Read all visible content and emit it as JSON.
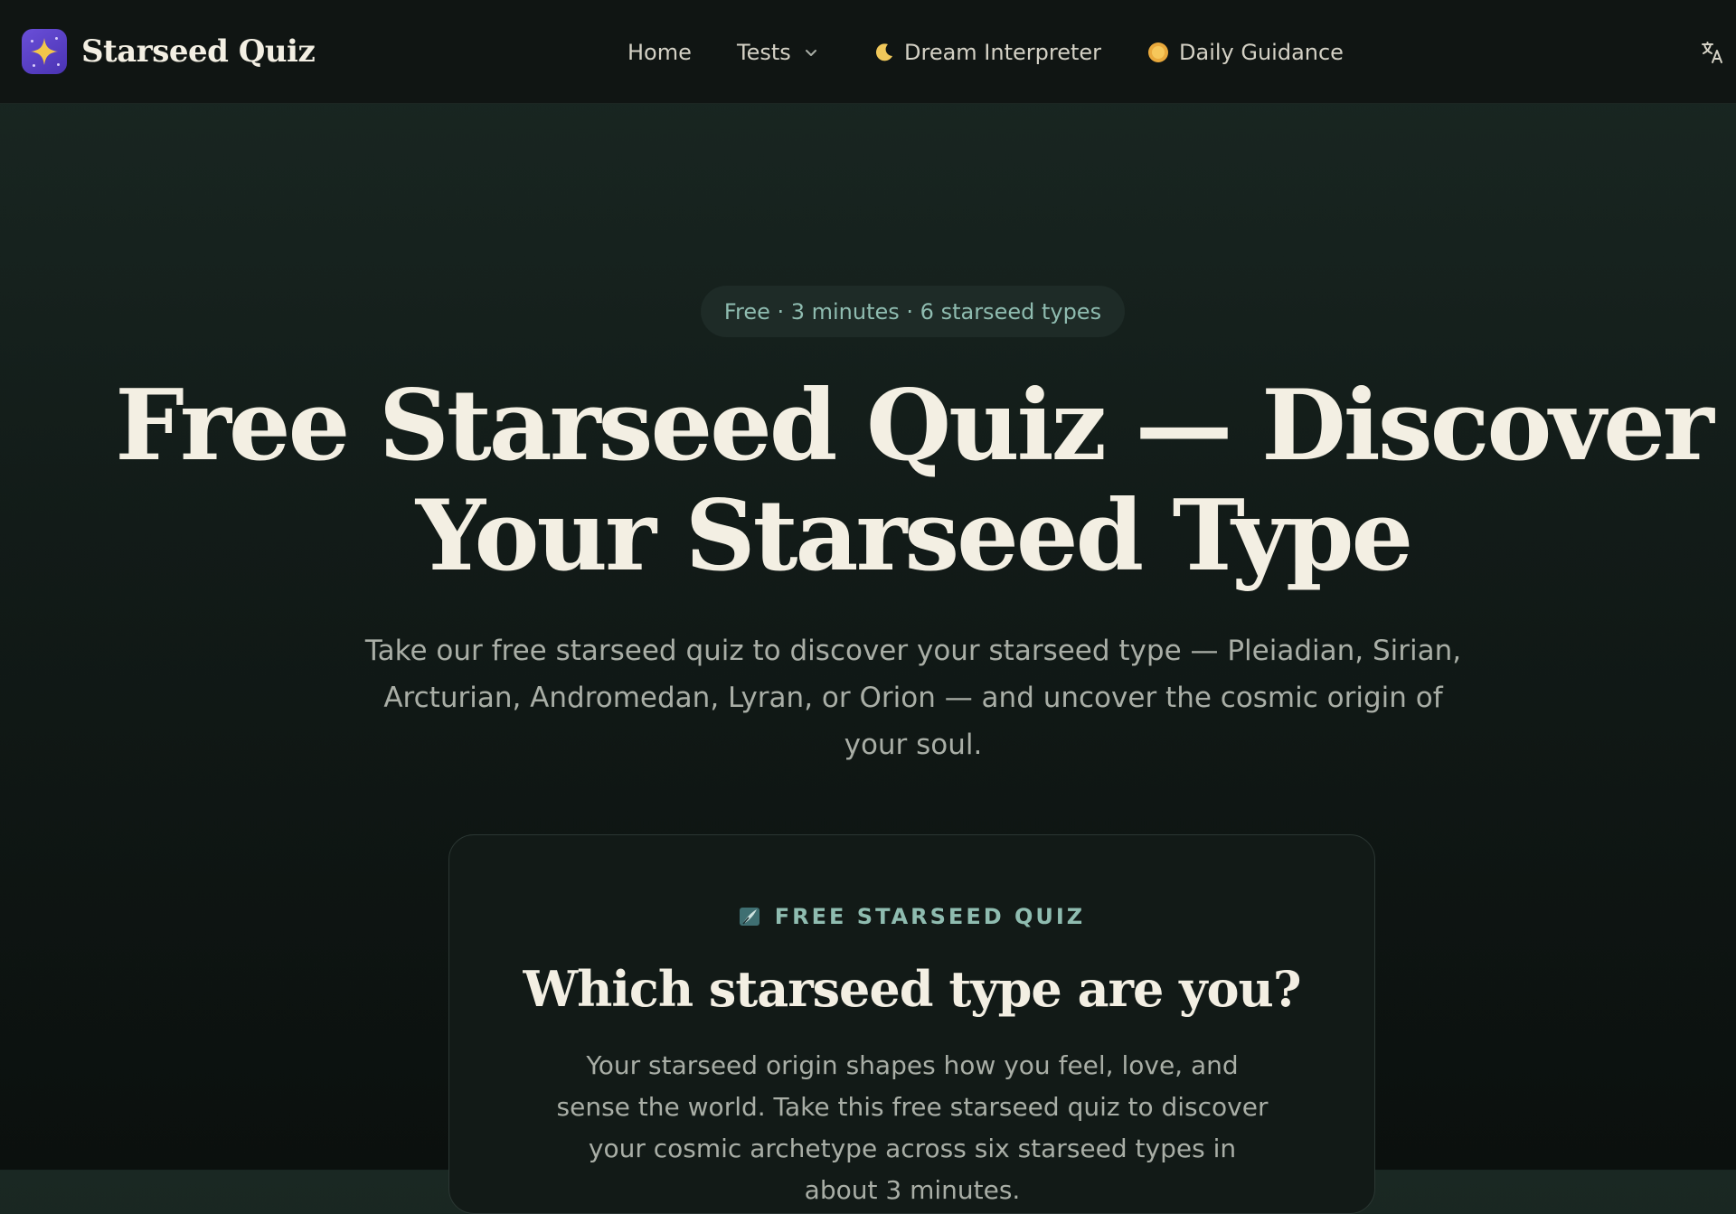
{
  "header": {
    "brand_name": "Starseed Quiz",
    "nav": {
      "home": "Home",
      "tests": "Tests",
      "dream": "Dream Interpreter",
      "daily": "Daily Guidance"
    },
    "icons": {
      "brand": "sparkle-star-icon",
      "tests_dropdown": "chevron-down-icon",
      "dream": "crescent-moon-icon",
      "daily": "sun-icon",
      "language": "translate-icon"
    }
  },
  "hero": {
    "badge": "Free · 3 minutes · 6 starseed types",
    "title_line1": "Free Starseed Quiz — Discover",
    "title_line2": "Your Starseed Type",
    "subtitle": "Take our free starseed quiz to discover your starseed type — Pleiadian, Sirian, Arcturian, Andromedan, Lyran, or Orion — and uncover the cosmic origin of your soul."
  },
  "quiz_card": {
    "kicker": "FREE STARSEED QUIZ",
    "kicker_icon": "quill-pen-icon",
    "title": "Which starseed type are you?",
    "body": "Your starseed origin shapes how you feel, love, and sense the world. Take this free starseed quiz to discover your cosmic archetype across six starseed types in about 3 minutes."
  },
  "colors": {
    "background_top": "#1a2823",
    "background_bottom": "#0b100e",
    "header_bg": "#101513",
    "accent_teal": "#8fbcb0",
    "brand_purple": "#5a3fc8",
    "brand_gold": "#f3c64b",
    "text_primary": "#f3efe3",
    "text_muted": "#a9aea6"
  }
}
